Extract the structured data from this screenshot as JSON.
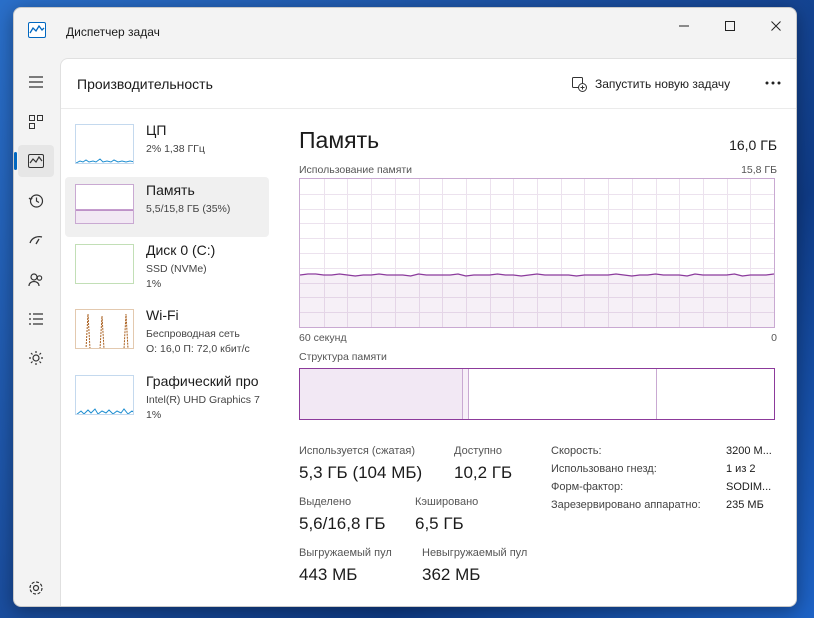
{
  "window": {
    "title": "Диспетчер задач"
  },
  "header": {
    "title": "Производительность",
    "run_task_label": "Запустить новую задачу"
  },
  "nav": {
    "items": [
      {
        "name": "menu-icon"
      },
      {
        "name": "processes-icon"
      },
      {
        "name": "performance-icon",
        "active": true
      },
      {
        "name": "app-history-icon"
      },
      {
        "name": "startup-apps-icon"
      },
      {
        "name": "users-icon"
      },
      {
        "name": "details-icon"
      },
      {
        "name": "services-icon"
      },
      {
        "name": "settings-icon"
      }
    ]
  },
  "sidebar": {
    "items": [
      {
        "name": "ЦП",
        "line1": "2% 1,38 ГГц",
        "line2": "",
        "line3": "",
        "color": "#1f8fd1"
      },
      {
        "name": "Память",
        "line1": "5,5/15,8 ГБ (35%)",
        "line2": "",
        "line3": "",
        "color": "#8b3a9c"
      },
      {
        "name": "Диск 0 (C:)",
        "line1": "SSD (NVMe)",
        "line2": "1%",
        "line3": "",
        "color": "#4ea72e"
      },
      {
        "name": "Wi-Fi",
        "line1": "Беспроводная сеть",
        "line2": "О: 16,0 П: 72,0 кбит/с",
        "line3": "",
        "color": "#a85d1b"
      },
      {
        "name": "Графический про",
        "line1": "Intel(R) UHD Graphics 7",
        "line2": "1%",
        "line3": "",
        "color": "#1f8fd1"
      }
    ]
  },
  "memory": {
    "title": "Память",
    "total": "16,0 ГБ",
    "usage_label": "Использование памяти",
    "usage_max": "15,8 ГБ",
    "time_left": "60 секунд",
    "time_right": "0",
    "structure_label": "Структура памяти",
    "usage_fraction": 0.35,
    "accent": "#8b3a9c",
    "stats": {
      "in_use_label": "Используется (сжатая)",
      "in_use_value": "5,3 ГБ (104 МБ)",
      "available_label": "Доступно",
      "available_value": "10,2 ГБ",
      "committed_label": "Выделено",
      "committed_value": "5,6/16,8 ГБ",
      "cached_label": "Кэшировано",
      "cached_value": "6,5 ГБ",
      "paged_label": "Выгружаемый пул",
      "paged_value": "443 МБ",
      "nonpaged_label": "Невыгружаемый пул",
      "nonpaged_value": "362 МБ"
    },
    "details": {
      "speed_label": "Скорость:",
      "speed_value": "3200 М...",
      "slots_label": "Использовано гнезд:",
      "slots_value": "1 из 2",
      "form_label": "Форм-фактор:",
      "form_value": "SODIM...",
      "reserved_label": "Зарезервировано аппаратно:",
      "reserved_value": "235 МБ"
    }
  }
}
